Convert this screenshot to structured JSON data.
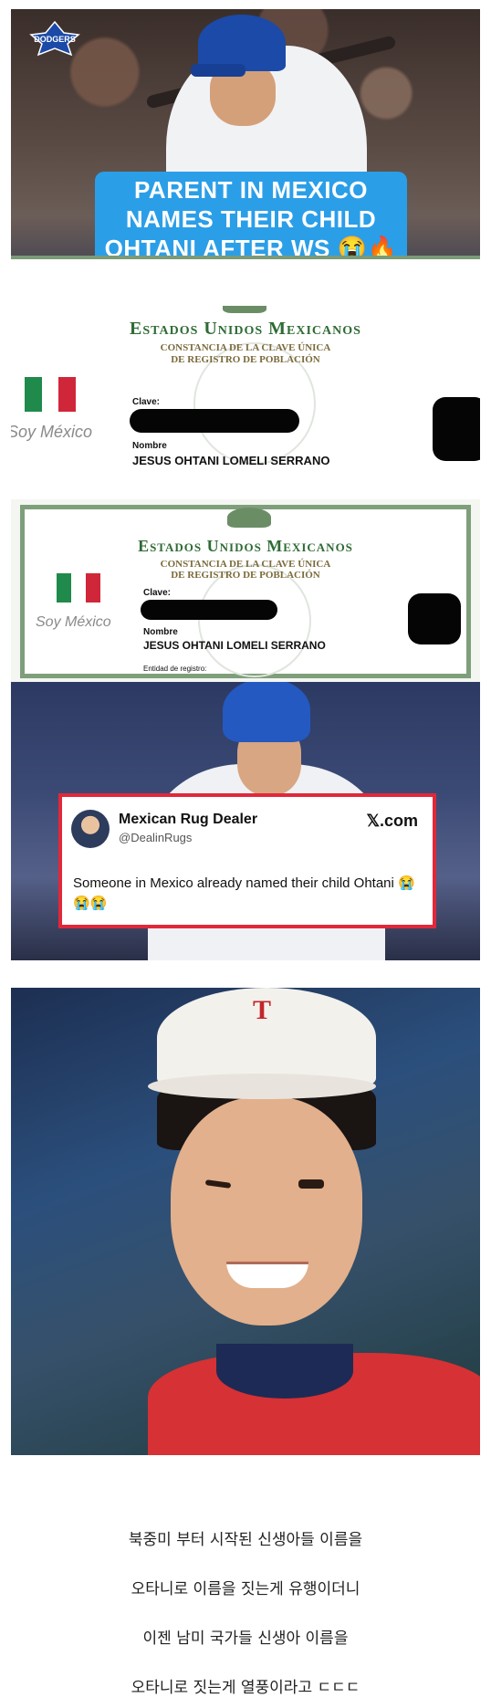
{
  "panel1": {
    "logo_text": "DODGERS",
    "caption_lines": [
      "PARENT IN MEXICO",
      "NAMES THEIR CHILD",
      "OHTANI AFTER WS 😭🔥"
    ]
  },
  "doc1": {
    "title": "Estados Unidos Mexicanos",
    "subtitle_lines": [
      "CONSTANCIA DE LA CLAVE ÚNICA",
      "DE REGISTRO DE POBLACIÓN"
    ],
    "soy_mexico": "Soy México",
    "clave_label": "Clave:",
    "nombre_label": "Nombre",
    "nombre_value": "JESUS OHTANI LOMELI SERRANO"
  },
  "doc2": {
    "title": "Estados Unidos Mexicanos",
    "subtitle_lines": [
      "CONSTANCIA DE LA CLAVE ÚNICA",
      "DE REGISTRO DE POBLACIÓN"
    ],
    "soy_mexico": "Soy México",
    "clave_label": "Clave:",
    "nombre_label": "Nombre",
    "nombre_value": "JESUS OHTANI LOMELI SERRANO",
    "entidad_label": "Entidad de registro:"
  },
  "tweet": {
    "display_name": "Mexican Rug Dealer",
    "handle": "@DealinRugs",
    "source": "𝕏.com",
    "text": "Someone in Mexico already named their child Ohtani 😭😭😭"
  },
  "korean_lines": [
    "북중미 부터 시작된  신생아들  이름을",
    "오타니로 이름을 짓는게 유행이더니",
    "이젠 남미 국가들 신생아 이름을",
    "오타니로 짓는게 열풍이라고   ㄷㄷㄷ"
  ],
  "colors": {
    "caption_bg": "#2b9ee8",
    "tweet_border": "#e1283a",
    "doc_green": "#2f6b34",
    "flag_green": "#1f8a4c",
    "flag_red": "#d0263a"
  }
}
